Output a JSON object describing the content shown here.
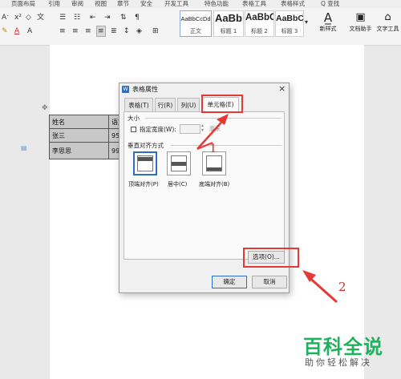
{
  "ribbon": {
    "tabs": [
      "页面布局",
      "引用",
      "审阅",
      "视图",
      "章节",
      "安全",
      "开发工具",
      "特色功能",
      "表格工具",
      "表格样式",
      "Q 查找"
    ],
    "styles": [
      {
        "sample": "AaBbCcDd",
        "label": "正文"
      },
      {
        "sample": "AaBb",
        "label": "标题 1"
      },
      {
        "sample": "AaBbC",
        "label": "标题 2"
      },
      {
        "sample": "AaBbC",
        "label": "标题 3"
      }
    ],
    "new_style": "新样式",
    "doc_helper": "文档助手",
    "text_tools": "文字工具"
  },
  "doc_table": {
    "rows": [
      [
        "姓名",
        "语文"
      ],
      [
        "张三",
        "95"
      ],
      [
        "李思思",
        "99"
      ]
    ]
  },
  "dialog": {
    "title": "表格属性",
    "close": "×",
    "tabs": [
      "表格(T)",
      "行(R)",
      "列(U)",
      "单元格(E)"
    ],
    "size_section": "大小",
    "specify_width": "指定宽度(W):",
    "width_unit": "厘米",
    "valign_section": "垂直对齐方式",
    "valign_options": [
      "顶端对齐(P)",
      "居中(C)",
      "底端对齐(B)"
    ],
    "options_button": "选项(O)...",
    "ok_button": "确定",
    "cancel_button": "取消"
  },
  "annotations": {
    "step1": "1",
    "step2": "2"
  },
  "watermark": {
    "title": "百科全说",
    "subtitle": "助你轻松解决"
  },
  "colors": {
    "accent_red": "#e53935",
    "watermark_green": "#1db35c",
    "dialog_blue": "#2f6dbd"
  }
}
